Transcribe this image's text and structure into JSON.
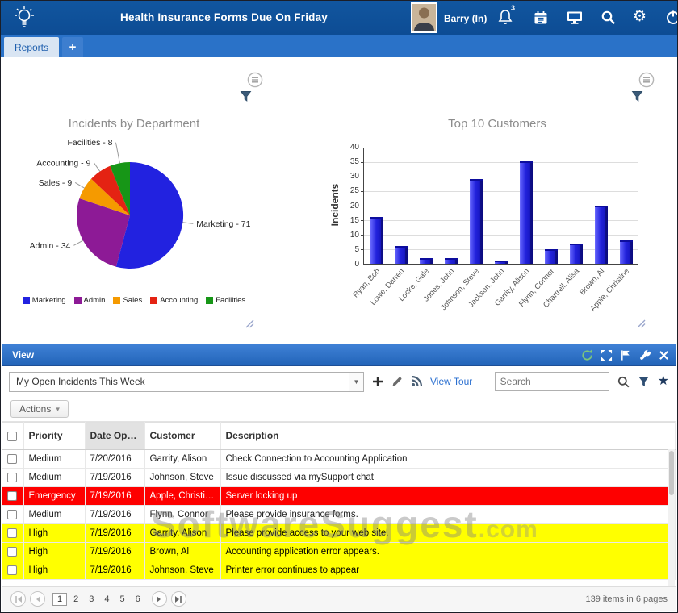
{
  "header": {
    "title": "Health Insurance Forms Due On Friday",
    "user_label": "Barry (In)",
    "notification_badge": "3"
  },
  "tabs": {
    "reports_label": "Reports",
    "add_label": "+"
  },
  "chart_data": [
    {
      "type": "pie",
      "title": "Incidents by Department",
      "labels": [
        "Marketing",
        "Admin",
        "Sales",
        "Accounting",
        "Facilities"
      ],
      "values": [
        71,
        34,
        9,
        9,
        8
      ],
      "colors": [
        "#2222e0",
        "#8d1a96",
        "#f59a00",
        "#e42313",
        "#179617"
      ],
      "label_format": "name - value",
      "legend_position": "bottom"
    },
    {
      "type": "bar",
      "title": "Top 10 Customers",
      "ylabel": "Incidents",
      "ylim": [
        0,
        40
      ],
      "ytick_step": 5,
      "categories": [
        "Ryan, Bob",
        "Lowe, Darren",
        "Locke, Gale",
        "Jones, John",
        "Johnson, Steve",
        "Jackson, John",
        "Garrity, Alison",
        "Flynn, Connor",
        "Chartrell, Alisa",
        "Brown, Al",
        "Apple, Christine"
      ],
      "values": [
        16,
        6,
        2,
        2,
        29,
        1,
        35,
        5,
        7,
        20,
        8
      ],
      "bar_color": "#2323dd",
      "grid": true
    }
  ],
  "view_panel": {
    "title": "View",
    "dropdown_value": "My Open Incidents This Week",
    "view_tour_label": "View Tour",
    "search_placeholder": "Search",
    "actions_label": "Actions",
    "table": {
      "columns": [
        "Priority",
        "Date Opened",
        "Customer",
        "Description"
      ],
      "sorted_column": "Date Opened",
      "sort_direction": "desc",
      "rows": [
        {
          "priority": "Medium",
          "date_opened": "7/20/2016",
          "customer": "Garrity, Alison",
          "description": "Check Connection to Accounting Application",
          "highlight": "none"
        },
        {
          "priority": "Medium",
          "date_opened": "7/19/2016",
          "customer": "Johnson, Steve",
          "description": "Issue discussed via mySupport chat",
          "highlight": "none"
        },
        {
          "priority": "Emergency",
          "date_opened": "7/19/2016",
          "customer": "Apple, Christine",
          "description": "Server locking up",
          "highlight": "red"
        },
        {
          "priority": "Medium",
          "date_opened": "7/19/2016",
          "customer": "Flynn, Connor",
          "description": "Please provide insurance forms.",
          "highlight": "none"
        },
        {
          "priority": "High",
          "date_opened": "7/19/2016",
          "customer": "Garrity, Alison",
          "description": "Please provide access to your web site.",
          "highlight": "yellow"
        },
        {
          "priority": "High",
          "date_opened": "7/19/2016",
          "customer": "Brown, Al",
          "description": "Accounting application error appears.",
          "highlight": "yellow"
        },
        {
          "priority": "High",
          "date_opened": "7/19/2016",
          "customer": "Johnson, Steve",
          "description": "Printer error continues to appear",
          "highlight": "yellow"
        }
      ]
    },
    "pagination": {
      "pages": [
        "1",
        "2",
        "3",
        "4",
        "5",
        "6"
      ],
      "current_page": "1",
      "summary": "139 items in 6 pages"
    }
  },
  "watermark": {
    "text": "SoftwareSuggest",
    "suffix": ".com"
  },
  "icons": {
    "gear": "⚙",
    "star": "★",
    "sort_desc": "▾",
    "dropdown_caret": "▼",
    "actions_caret": "▾"
  },
  "colors": {
    "header_bg": "#0f55a5",
    "tab_bar_bg": "#2a72c8",
    "panel_header_bg": "#2f6fc4",
    "emergency_row_bg": "#fe0000",
    "emergency_row_text": "#ffffff",
    "high_row_bg": "#ffff00",
    "high_row_text": "#000000"
  }
}
